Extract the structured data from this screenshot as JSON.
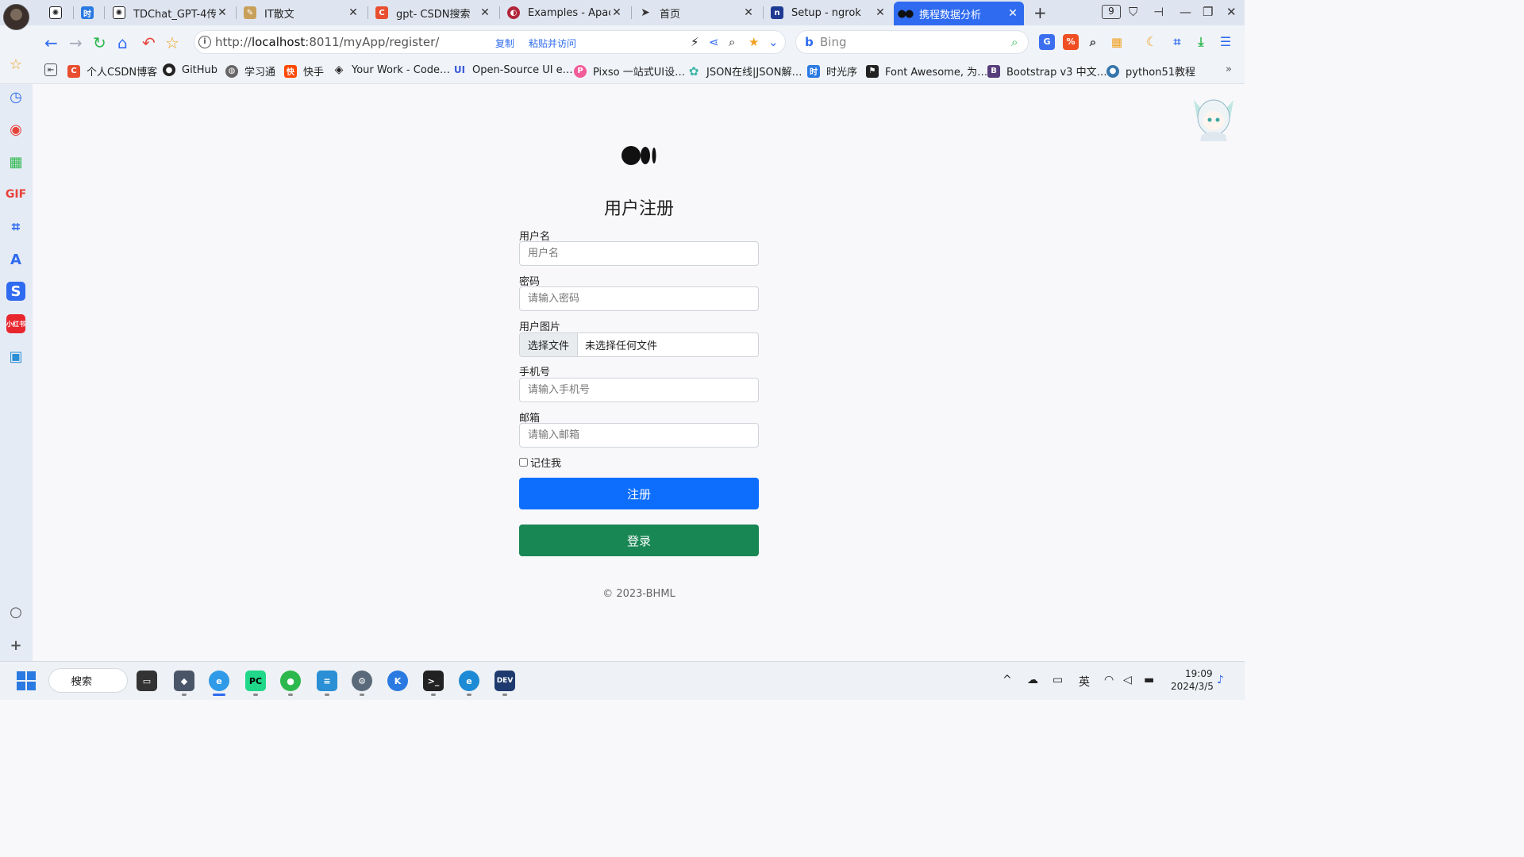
{
  "tabs": [
    {
      "title": "",
      "favicon": "chatgpt-icon",
      "color": "#222"
    },
    {
      "title": "",
      "favicon": "calendar-icon",
      "color": "#2a7ae2"
    },
    {
      "title": "TDChat_GPT-4传…",
      "favicon": "chatgpt-icon",
      "color": "#222"
    },
    {
      "title": "IT散文",
      "favicon": "writing-icon",
      "color": "#c9a05a"
    },
    {
      "title": "gpt- CSDN搜索",
      "favicon": "csdn-icon",
      "color": "#e84e2f"
    },
    {
      "title": "Examples - Apac…",
      "favicon": "apache-icon",
      "color": "#b2263a"
    },
    {
      "title": "首页",
      "favicon": "paper-plane-icon",
      "color": "#333"
    },
    {
      "title": "Setup - ngrok",
      "favicon": "ngrok-icon",
      "color": "#1f3a93"
    },
    {
      "title": "携程数据分析",
      "favicon": "medium-icon",
      "color": "#111"
    }
  ],
  "tab_count": "9",
  "address": {
    "url_prefix": "http://",
    "url_host": "localhost",
    "url_rest": ":8011/myApp/register/",
    "copy_label": "复制",
    "paste_go_label": "粘贴并访问",
    "search_engine": "Bing"
  },
  "bookmarks": [
    {
      "label": "个人CSDN博客",
      "icon": "csdn-icon",
      "color": "#e84e2f"
    },
    {
      "label": "GitHub",
      "icon": "github-icon",
      "color": "#222"
    },
    {
      "label": "学习通",
      "icon": "globe-icon",
      "color": "#555"
    },
    {
      "label": "快手",
      "icon": "kuaishou-icon",
      "color": "#ff4906"
    },
    {
      "label": "Your Work - Code…",
      "icon": "codepen-icon",
      "color": "#222"
    },
    {
      "label": "Open-Source UI e…",
      "icon": "ui-icon",
      "color": "#3b5bdb"
    },
    {
      "label": "Pixso 一站式UI设…",
      "icon": "pixso-icon",
      "color": "#f25c98"
    },
    {
      "label": "JSON在线|JSON解…",
      "icon": "gear-icon",
      "color": "#3bb6a8"
    },
    {
      "label": "时光序",
      "icon": "calendar-icon",
      "color": "#2a7ae2"
    },
    {
      "label": "Font Awesome, 为…",
      "icon": "flag-icon",
      "color": "#222"
    },
    {
      "label": "Bootstrap v3 中文…",
      "icon": "bootstrap-icon",
      "color": "#563d7c"
    },
    {
      "label": "python51教程",
      "icon": "python-icon",
      "color": "#3776ab"
    }
  ],
  "form": {
    "title": "用户注册",
    "username_label": "用户名",
    "username_placeholder": "用户名",
    "password_label": "密码",
    "password_placeholder": "请输入密码",
    "image_label": "用户图片",
    "file_button": "选择文件",
    "file_status": "未选择任何文件",
    "phone_label": "手机号",
    "phone_placeholder": "请输入手机号",
    "email_label": "邮箱",
    "email_placeholder": "请输入邮箱",
    "remember_label": "记住我",
    "register_button": "注册",
    "login_button": "登录",
    "footer": "© 2023-BHML"
  },
  "taskbar": {
    "search_label": "搜索",
    "ime_label": "英",
    "time": "19:09",
    "date": "2024/3/5"
  },
  "colors": {
    "primary": "#0d6efd",
    "success": "#198754",
    "active_tab": "#2f6bf0"
  }
}
